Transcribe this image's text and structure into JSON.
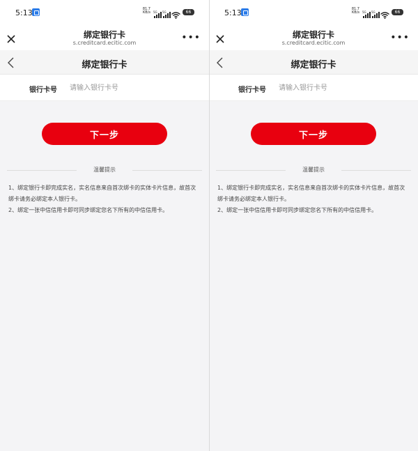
{
  "screens": [
    {
      "status": {
        "time": "5:13",
        "rate_top": "81.7",
        "rate_bottom": "KB/s",
        "net1": "5G",
        "net2": "5G",
        "battery": "66"
      },
      "titlebar": {
        "title": "绑定银行卡",
        "url": "s.creditcard.ecitic.com",
        "more": "•••"
      },
      "navbar": {
        "title": "绑定银行卡"
      },
      "form": {
        "label": "银行卡号",
        "placeholder": "请输入银行卡号",
        "value": ""
      },
      "next_button": "下一步",
      "tips": {
        "title": "温馨提示",
        "items": [
          "1、绑定银行卡即完成实名，实名信息来自首次绑卡的实体卡片信息，故首次绑卡请务必绑定本人银行卡。",
          "2、绑定一张中信信用卡即可同步绑定您名下所有的中信信用卡。"
        ]
      }
    },
    {
      "status": {
        "time": "5:13",
        "rate_top": "81.7",
        "rate_bottom": "KB/s",
        "net1": "5G",
        "net2": "5G",
        "battery": "66"
      },
      "titlebar": {
        "title": "绑定银行卡",
        "url": "s.creditcard.ecitic.com",
        "more": "•••"
      },
      "navbar": {
        "title": "绑定银行卡"
      },
      "form": {
        "label": "银行卡号",
        "placeholder": "请输入银行卡号",
        "value": ""
      },
      "next_button": "下一步",
      "tips": {
        "title": "温馨提示",
        "items": [
          "1、绑定银行卡即完成实名，实名信息来自首次绑卡的实体卡片信息，故首次绑卡请务必绑定本人银行卡。",
          "2、绑定一张中信信用卡即可同步绑定您名下所有的中信信用卡。"
        ]
      }
    }
  ],
  "colors": {
    "accent": "#e8000f",
    "background": "#f4f4f6",
    "surface": "#ffffff"
  },
  "icons": {
    "close": "close-icon",
    "more": "more-icon",
    "back": "back-chevron-icon",
    "wifi": "wifi-icon",
    "signal": "signal-icon",
    "battery": "battery-icon"
  }
}
